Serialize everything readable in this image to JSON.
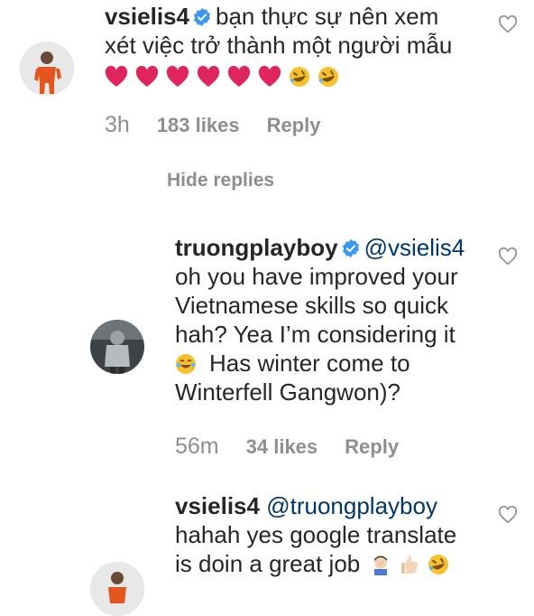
{
  "comments": [
    {
      "username": "vsielis4",
      "text_line1": "bạn thực sự nên xem",
      "text_line2": "xét việc trở thành một người mẫu",
      "time": "3h",
      "likes": "183 likes",
      "reply_label": "Reply"
    }
  ],
  "hide_replies_label": "Hide replies",
  "replies": [
    {
      "username": "truongplayboy",
      "mention": "@vsielis4",
      "line1": "oh you have improved your",
      "line2": "Vietnamese skills so quick",
      "line3": "hah? Yea I’m considering it",
      "line4": "Has winter come to",
      "line5": "Winterfell Gangwon)?",
      "time": "56m",
      "likes": "34 likes",
      "reply_label": "Reply"
    },
    {
      "username": "vsielis4",
      "mention": "@truongplayboy",
      "line1": "hahah yes google translate",
      "line2": "is doin a great job"
    }
  ],
  "icons": {
    "verified": "verified-badge-icon",
    "like": "heart-outline-icon"
  },
  "colors": {
    "verified_blue": "#3897f0",
    "mention": "#00376b",
    "meta_gray": "#8e8e8e",
    "heart_red": "#e0245e"
  }
}
